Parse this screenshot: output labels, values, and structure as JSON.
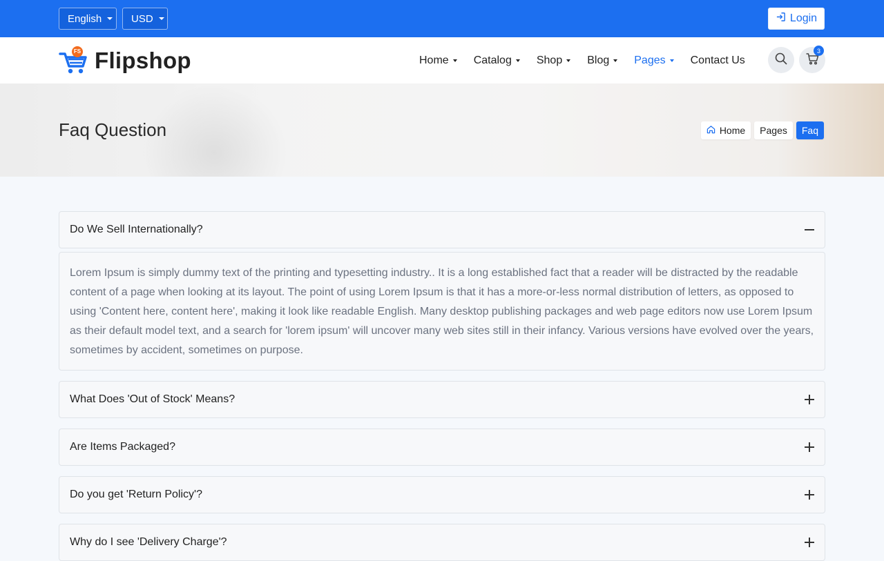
{
  "topbar": {
    "language": "English",
    "currency": "USD",
    "login_label": "Login",
    "accent": "#1c6ff0"
  },
  "header": {
    "logo_text": "Flipshop",
    "logo_badge": "FS",
    "nav": [
      {
        "label": "Home",
        "has_dropdown": true,
        "active": false
      },
      {
        "label": "Catalog",
        "has_dropdown": true,
        "active": false
      },
      {
        "label": "Shop",
        "has_dropdown": true,
        "active": false
      },
      {
        "label": "Blog",
        "has_dropdown": true,
        "active": false
      },
      {
        "label": "Pages",
        "has_dropdown": true,
        "active": true
      },
      {
        "label": "Contact Us",
        "has_dropdown": false,
        "active": false
      }
    ],
    "search_icon": "search-icon",
    "cart_icon": "cart-icon",
    "cart_count": "3"
  },
  "hero": {
    "title": "Faq Question",
    "breadcrumb": [
      {
        "label": "Home",
        "icon": "home-icon"
      },
      {
        "label": "Pages"
      },
      {
        "label": "Faq",
        "active": true
      }
    ]
  },
  "faq": [
    {
      "question": "Do We Sell Internationally?",
      "expanded": true,
      "answer": "Lorem Ipsum is simply dummy text of the printing and typesetting industry.. It is a long established fact that a reader will be distracted by the readable content of a page when looking at its layout. The point of using Lorem Ipsum is that it has a more-or-less normal distribution of letters, as opposed to using 'Content here, content here', making it look like readable English. Many desktop publishing packages and web page editors now use Lorem Ipsum as their default model text, and a search for 'lorem ipsum' will uncover many web sites still in their infancy. Various versions have evolved over the years, sometimes by accident, sometimes on purpose."
    },
    {
      "question": "What Does 'Out of Stock' Means?",
      "expanded": false
    },
    {
      "question": "Are Items Packaged?",
      "expanded": false
    },
    {
      "question": "Do you get 'Return Policy'?",
      "expanded": false
    },
    {
      "question": "Why do I see 'Delivery Charge'?",
      "expanded": false
    }
  ]
}
